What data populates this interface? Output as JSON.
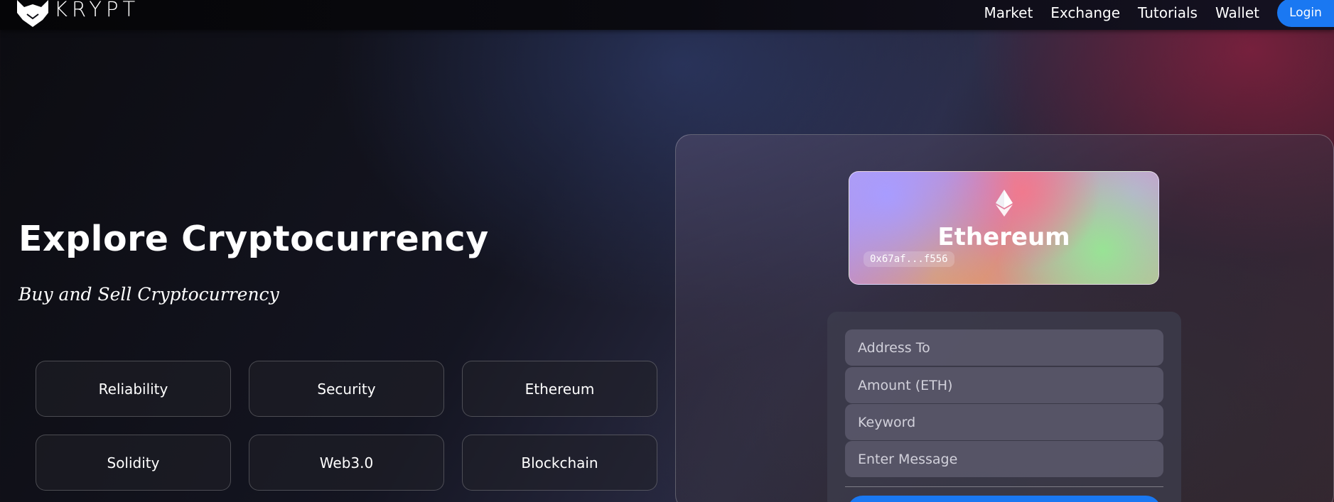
{
  "brand": {
    "name": "KRYPT",
    "logo_icon": "fox-icon"
  },
  "nav": {
    "links": [
      "Market",
      "Exchange",
      "Tutorials",
      "Wallet"
    ],
    "login_label": "Login"
  },
  "hero": {
    "title": "Explore Cryptocurrency",
    "subtitle": "Buy and Sell Cryptocurrency",
    "features": [
      "Reliability",
      "Security",
      "Ethereum",
      "Solidity",
      "Web3.0",
      "Blockchain"
    ]
  },
  "card": {
    "icon": "ethereum-icon",
    "name": "Ethereum",
    "address": "0x67af...f556"
  },
  "form": {
    "address_placeholder": "Address To",
    "amount_placeholder": "Amount (ETH)",
    "keyword_placeholder": "Keyword",
    "message_placeholder": "Enter Message"
  },
  "colors": {
    "accent": "#1a78f2"
  }
}
